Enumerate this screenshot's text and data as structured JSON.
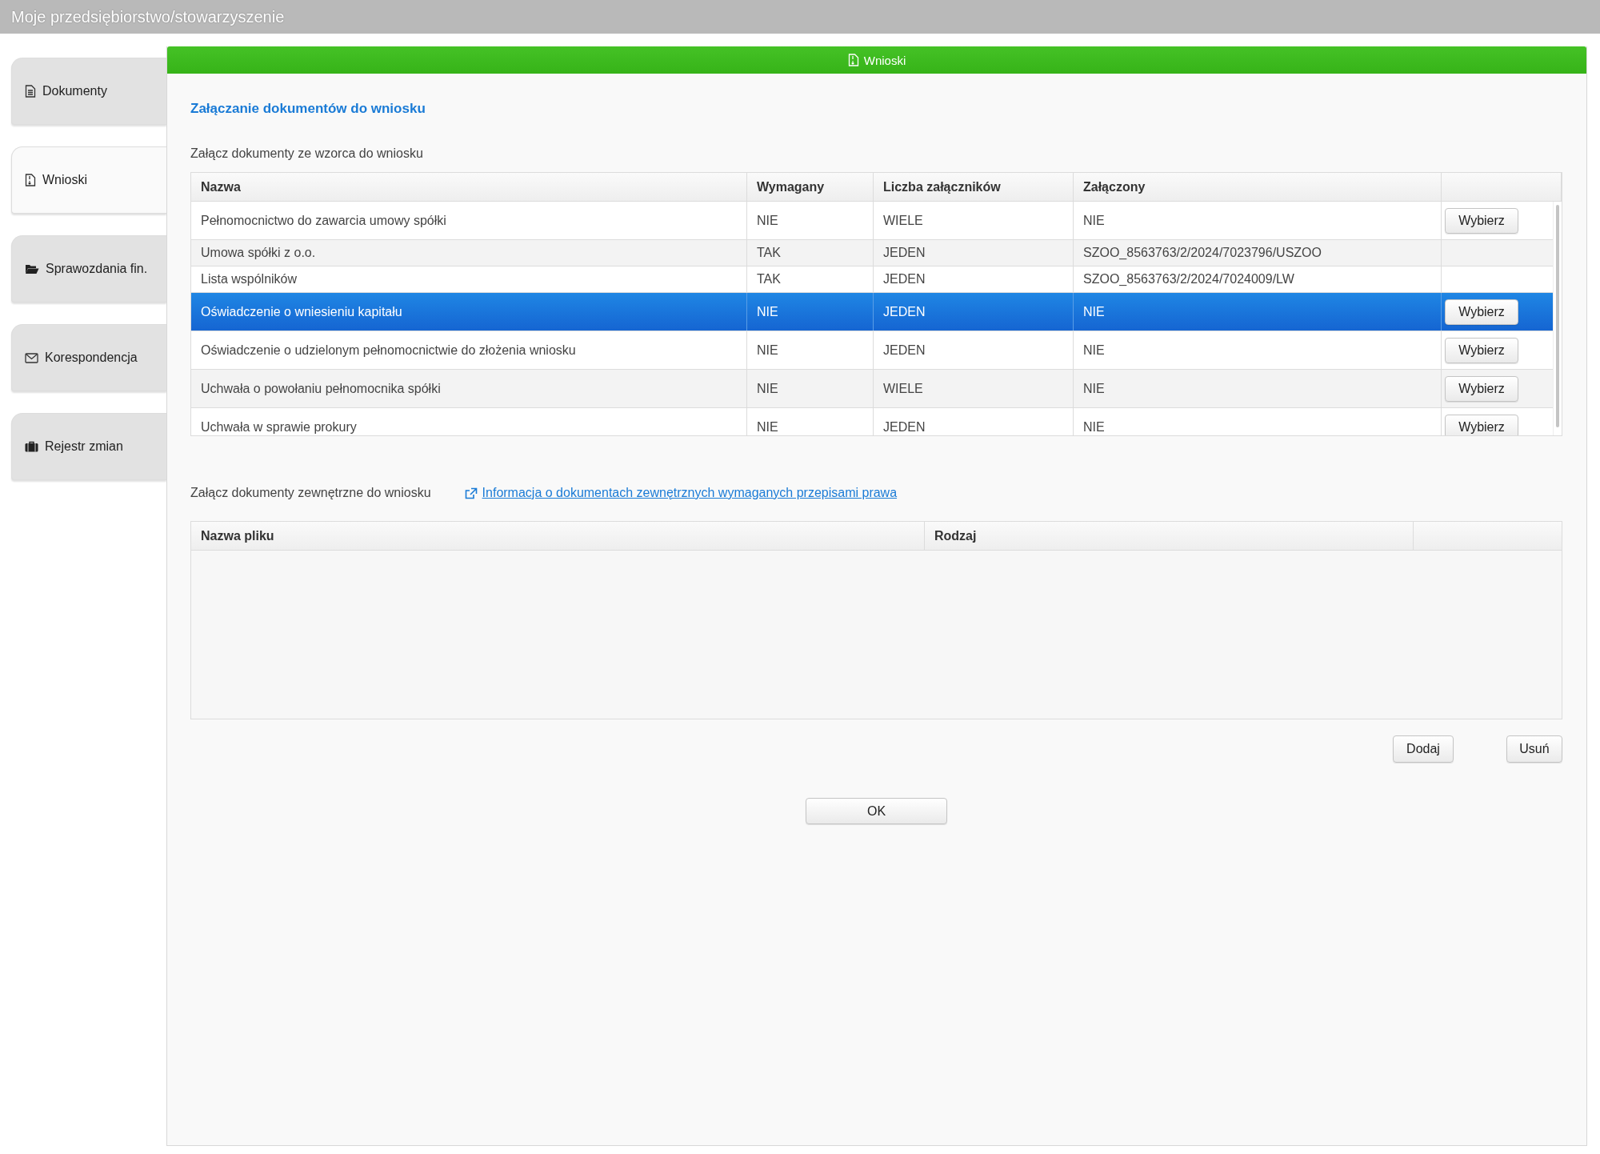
{
  "window": {
    "title": "Moje przedsiębiorstwo/stowarzyszenie"
  },
  "sidebar": {
    "items": [
      {
        "label": "Dokumenty",
        "selected": false
      },
      {
        "label": "Wnioski",
        "selected": true
      },
      {
        "label": "Sprawozdania fin.",
        "selected": false
      },
      {
        "label": "Korespondencja",
        "selected": false
      },
      {
        "label": "Rejestr zmian",
        "selected": false
      }
    ]
  },
  "panel": {
    "header": "Wnioski",
    "heading": "Załączanie dokumentów do wniosku",
    "template_section": {
      "label": "Załącz dokumenty ze wzorca do wniosku",
      "columns": [
        "Nazwa",
        "Wymagany",
        "Liczba załączników",
        "Załączony"
      ],
      "rows": [
        {
          "name": "Pełnomocnictwo do zawarcia umowy spółki",
          "required": "NIE",
          "count": "WIELE",
          "attached": "NIE",
          "action": "Wybierz",
          "selected": false
        },
        {
          "name": "Umowa spółki z o.o.",
          "required": "TAK",
          "count": "JEDEN",
          "attached": "SZOO_8563763/2/2024/7023796/USZOO",
          "selected": false
        },
        {
          "name": "Lista wspólników",
          "required": "TAK",
          "count": "JEDEN",
          "attached": "SZOO_8563763/2/2024/7024009/LW",
          "selected": false
        },
        {
          "name": "Oświadczenie o wniesieniu kapitału",
          "required": "NIE",
          "count": "JEDEN",
          "attached": "NIE",
          "action": "Wybierz",
          "selected": true
        },
        {
          "name": "Oświadczenie o udzielonym pełnomocnictwie do złożenia wniosku",
          "required": "NIE",
          "count": "JEDEN",
          "attached": "NIE",
          "action": "Wybierz",
          "selected": false
        },
        {
          "name": "Uchwała o powołaniu pełnomocnika spółki",
          "required": "NIE",
          "count": "WIELE",
          "attached": "NIE",
          "action": "Wybierz",
          "selected": false
        },
        {
          "name": "Uchwała w sprawie prokury",
          "required": "NIE",
          "count": "JEDEN",
          "attached": "NIE",
          "action": "Wybierz",
          "selected": false
        }
      ]
    },
    "external_section": {
      "label": "Załącz dokumenty zewnętrzne do wniosku",
      "link": "Informacja o dokumentach zewnętrznych wymaganych przepisami prawa",
      "columns": [
        "Nazwa pliku",
        "Rodzaj"
      ],
      "buttons": [
        "Dodaj",
        "Usuń"
      ]
    },
    "ok_button": "OK"
  }
}
